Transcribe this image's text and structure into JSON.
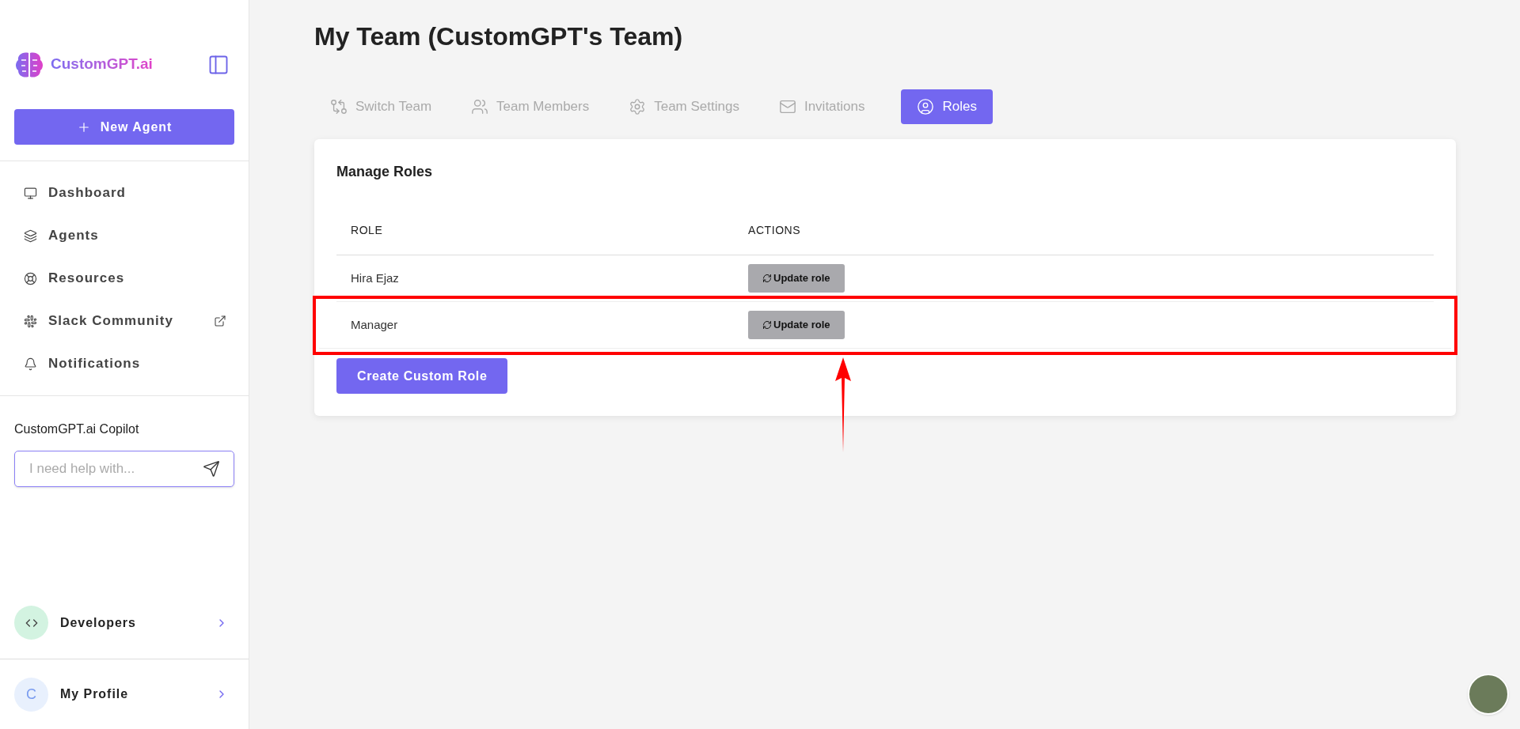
{
  "sidebar": {
    "logo_text": "CustomGPT.ai",
    "new_agent_button": "New Agent",
    "nav": [
      {
        "label": "Dashboard",
        "external": false
      },
      {
        "label": "Agents",
        "external": false
      },
      {
        "label": "Resources",
        "external": false
      },
      {
        "label": "Slack Community",
        "external": true
      },
      {
        "label": "Notifications",
        "external": false
      }
    ],
    "copilot": {
      "title": "CustomGPT.ai Copilot",
      "placeholder": "I need help with..."
    },
    "developers": {
      "label": "Developers"
    },
    "profile": {
      "initial": "C",
      "label": "My Profile"
    }
  },
  "main": {
    "title": "My Team (CustomGPT's Team)",
    "tabs": [
      {
        "label": "Switch Team",
        "selected": false
      },
      {
        "label": "Team Members",
        "selected": false
      },
      {
        "label": "Team Settings",
        "selected": false
      },
      {
        "label": "Invitations",
        "selected": false
      },
      {
        "label": "Roles",
        "selected": true
      }
    ],
    "card": {
      "title": "Manage Roles",
      "columns": [
        "ROLE",
        "ACTIONS"
      ],
      "rows": [
        {
          "role": "Hira Ejaz",
          "action": "Update role",
          "highlighted": false
        },
        {
          "role": "Manager",
          "action": "Update role",
          "highlighted": true
        }
      ],
      "create_button": "Create Custom Role"
    }
  }
}
